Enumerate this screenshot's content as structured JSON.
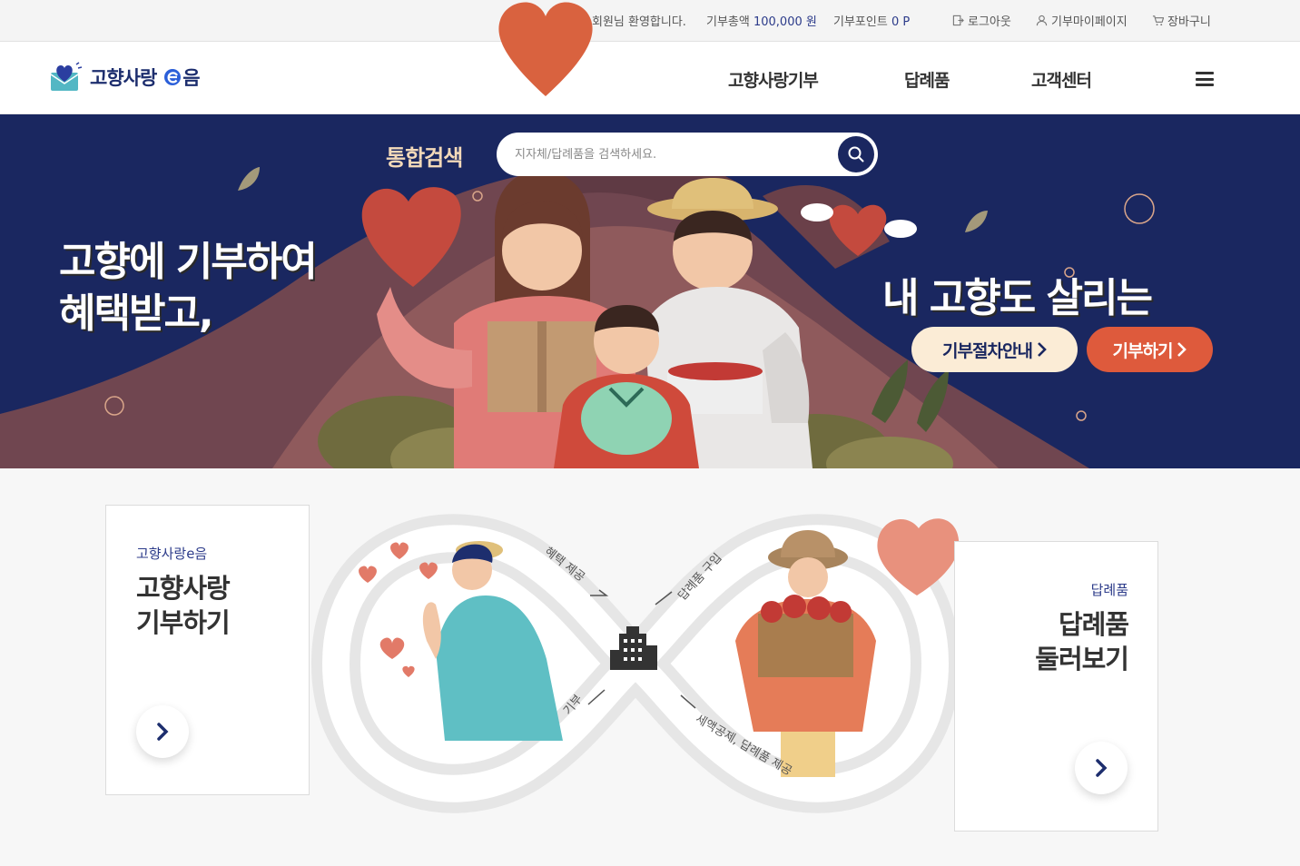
{
  "topbar": {
    "welcome": "회원님 환영합니다.",
    "donation_total_label": "기부총액",
    "donation_total_value": "100,000 원",
    "points_label": "기부포인트",
    "points_value": "0 P",
    "logout": "로그아웃",
    "mypage": "기부마이페이지",
    "cart": "장바구니"
  },
  "header": {
    "logo_text": "고향사랑",
    "logo_suffix": "음",
    "nav": [
      "고향사랑기부",
      "답례품",
      "고객센터"
    ]
  },
  "hero": {
    "search_label": "통합검색",
    "search_placeholder": "지자체/답례품을 검색하세요.",
    "left_line1": "고향에 기부하여",
    "left_line2": "혜택받고,",
    "right_line": "내 고향도 살리는",
    "btn_guide": "기부절차안내",
    "btn_donate": "기부하기"
  },
  "cards": {
    "left_sub": "고향사랑e음",
    "left_title_1": "고향사랑",
    "left_title_2": "기부하기",
    "right_sub": "답례품",
    "right_title_1": "답례품",
    "right_title_2": "둘러보기"
  },
  "flow": {
    "benefit": "혜택 제공",
    "purchase": "답례품 구입",
    "donate": "기부",
    "tax": "세액공제, 답례품 제공"
  },
  "colors": {
    "navy": "#1a2760",
    "accent_orange": "#de5a3c",
    "cream": "#fbecd6",
    "heart": "#d9623f"
  }
}
